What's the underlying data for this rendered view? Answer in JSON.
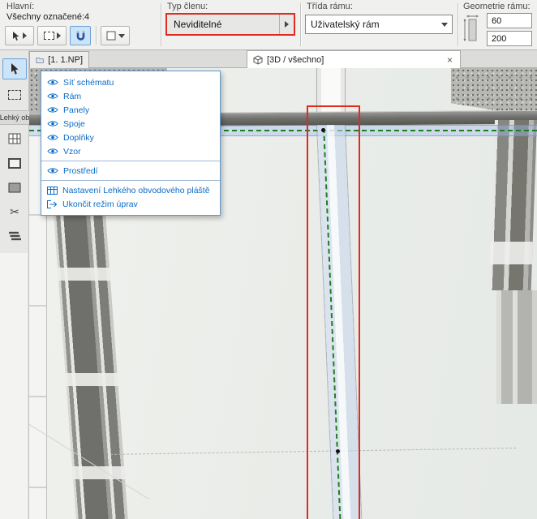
{
  "toolbar": {
    "main_label": "Hlavní:",
    "selection_status": "Všechny označené:4",
    "member_type_label": "Typ členu:",
    "member_type_value": "Neviditelné",
    "frame_class_label": "Třída rámu:",
    "frame_class_value": "Uživatelský rám",
    "frame_geometry_label": "Geometrie rámu:",
    "frame_width": "60",
    "frame_depth": "200"
  },
  "tabs": {
    "plan_tab": "[1. 1.NP]",
    "view_tab": "[3D / všechno]"
  },
  "left_palette": {
    "caption": "Lehký ob"
  },
  "panel": {
    "items": [
      {
        "label": "Síť schématu"
      },
      {
        "label": "Rám"
      },
      {
        "label": "Panely"
      },
      {
        "label": "Spoje"
      },
      {
        "label": "Doplňky"
      },
      {
        "label": "Vzor"
      },
      {
        "label": "Prostředí"
      },
      {
        "label": "Nastavení Lehkého obvodového pláště"
      },
      {
        "label": "Ukončit režim úprav"
      }
    ]
  },
  "icons": {
    "scissors_glyph": "✂",
    "close_glyph": "×"
  },
  "colors": {
    "accent_blue": "#0a6cc8",
    "selection_red": "#e12b1f",
    "grid_green": "#1e7d1e",
    "highlight_blue": "#b9cdeb",
    "toolbar_bg": "#f0f0ee"
  }
}
